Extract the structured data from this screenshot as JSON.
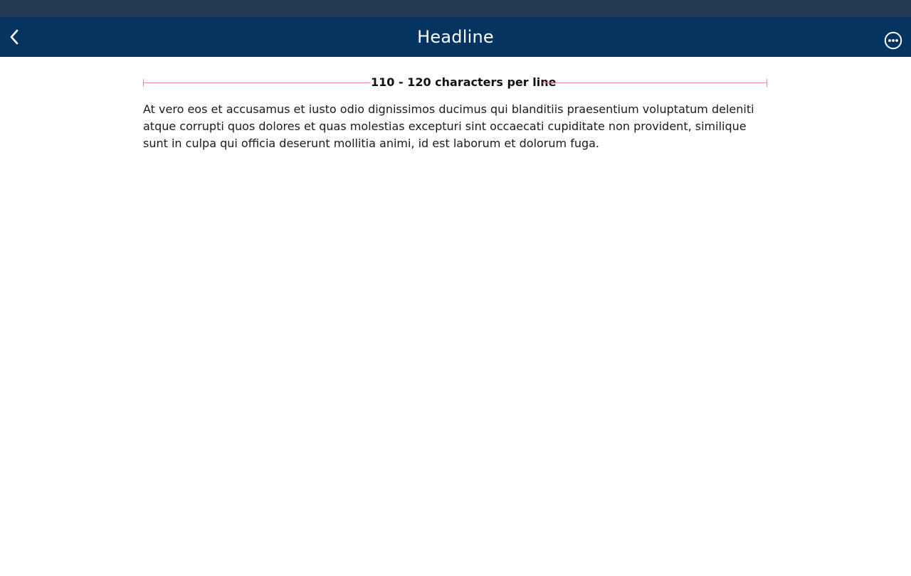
{
  "nav": {
    "title": "Headline",
    "back_icon": "chevron-left-icon",
    "more_icon": "more-horizontal-circle-icon"
  },
  "measure": {
    "label": "110 - 120 characters per line",
    "line_color": "#ee86b0"
  },
  "content": {
    "paragraph": "At vero eos et accusamus et iusto odio dignissimos ducimus qui blanditiis praesentium voluptatum deleniti atque corrupti quos dolores et quas molestias excepturi sint occaecati cupiditate non provident, similique sunt in culpa qui officia deserunt mollitia animi, id est laborum et dolorum fuga."
  },
  "colors": {
    "status_bar": "#263a52",
    "nav_bar": "#063461",
    "background": "#ffffff"
  }
}
